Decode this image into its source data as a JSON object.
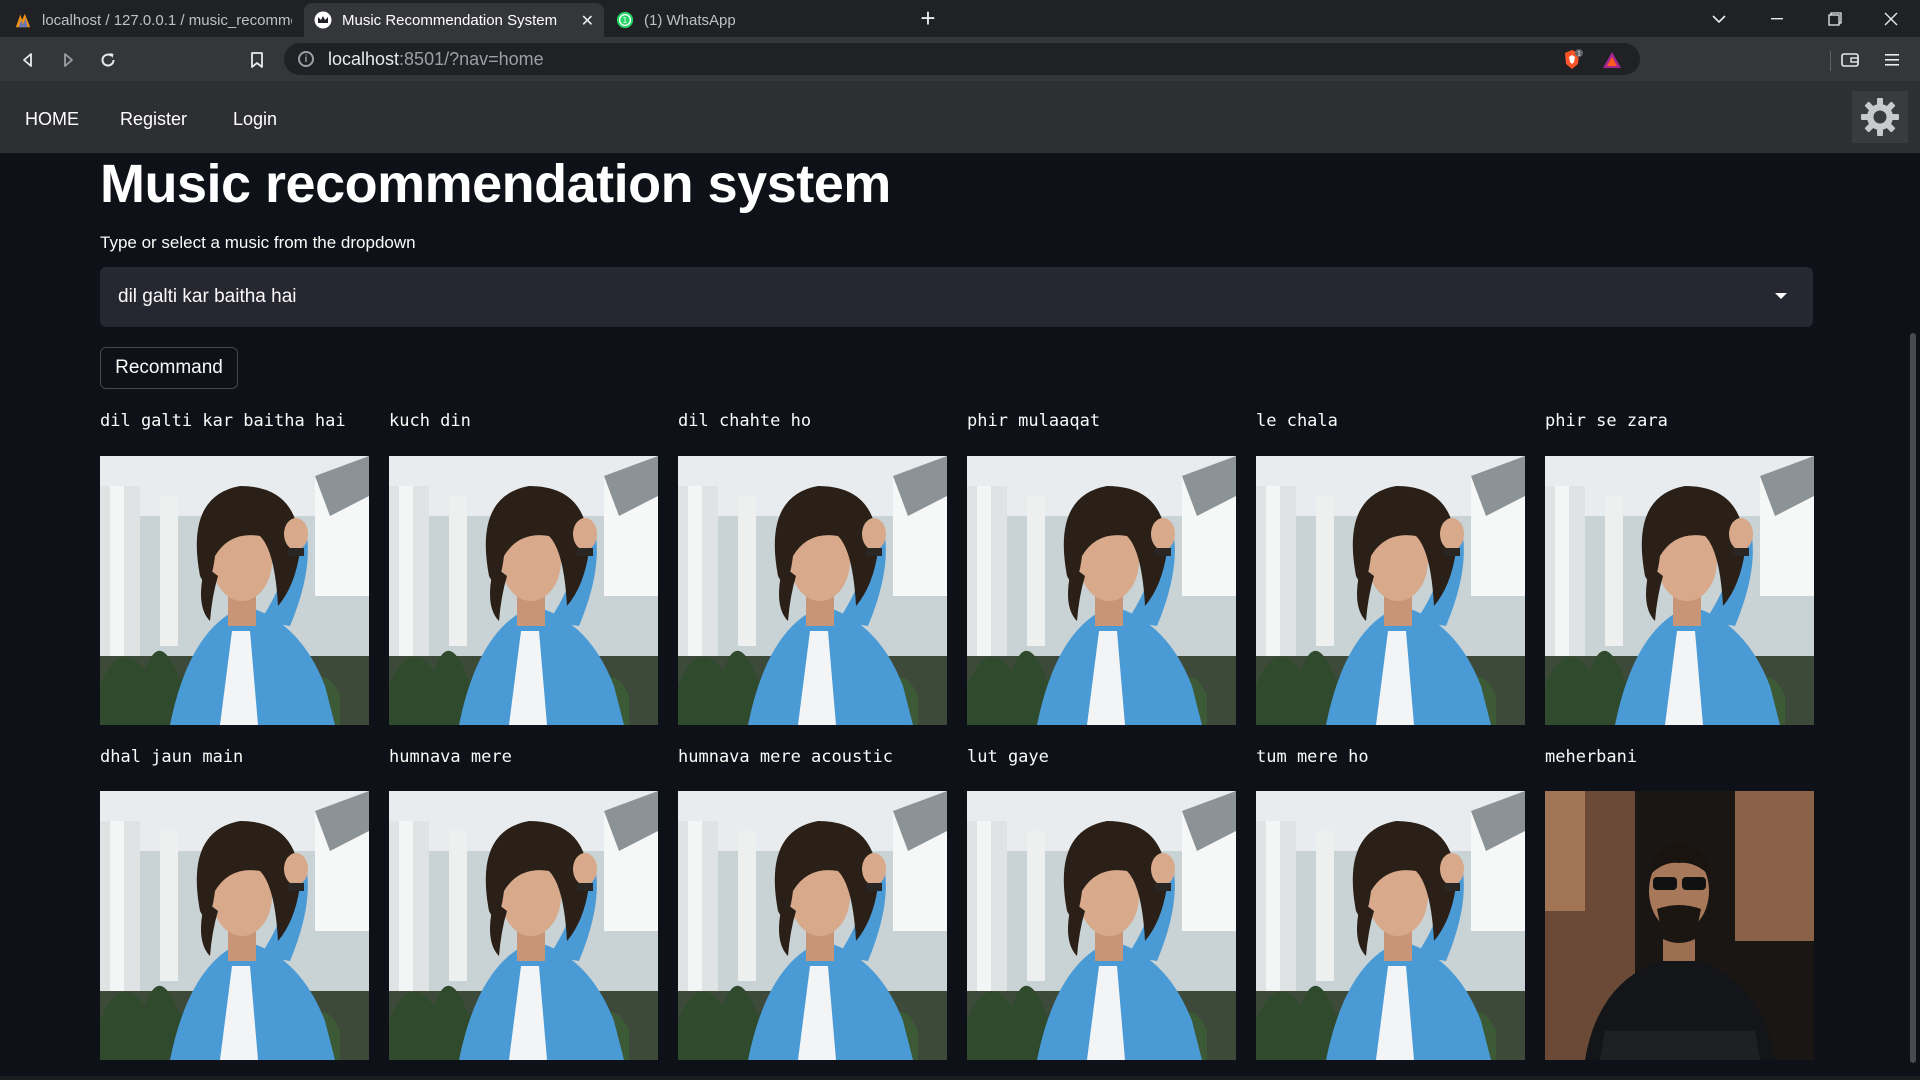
{
  "browser": {
    "tabs": [
      {
        "label": "localhost / 127.0.0.1 / music_recomme",
        "icon": "phpmyadmin-icon",
        "active": false
      },
      {
        "label": "Music Recommendation System",
        "icon": "streamlit-crown-icon",
        "active": true
      },
      {
        "label": "(1) WhatsApp",
        "icon": "whatsapp-icon",
        "active": false
      }
    ],
    "url_host": "localhost",
    "url_rest": ":8501/?nav=home"
  },
  "nav": {
    "home": "HOME",
    "register": "Register",
    "login": "Login"
  },
  "page": {
    "title": "Music recommendation system",
    "select_label": "Type or select a music from the dropdown",
    "selected_song": "dil galti kar baitha hai",
    "recommend_button": "Recommand"
  },
  "results": [
    {
      "title": "dil galti kar baitha hai",
      "artist_image": "curly-hair-blue-shirt"
    },
    {
      "title": "kuch din",
      "artist_image": "curly-hair-blue-shirt"
    },
    {
      "title": "dil chahte ho",
      "artist_image": "curly-hair-blue-shirt"
    },
    {
      "title": "phir mulaaqat",
      "artist_image": "curly-hair-blue-shirt"
    },
    {
      "title": "le chala",
      "artist_image": "curly-hair-blue-shirt"
    },
    {
      "title": "phir se zara",
      "artist_image": "curly-hair-blue-shirt"
    },
    {
      "title": "dhal jaun main",
      "artist_image": "curly-hair-blue-shirt"
    },
    {
      "title": "humnava mere",
      "artist_image": "curly-hair-blue-shirt"
    },
    {
      "title": "humnava mere acoustic",
      "artist_image": "curly-hair-blue-shirt"
    },
    {
      "title": "lut gaye",
      "artist_image": "curly-hair-blue-shirt"
    },
    {
      "title": "tum mere ho",
      "artist_image": "curly-hair-blue-shirt"
    },
    {
      "title": "meherbani",
      "artist_image": "sunglasses-black-shirt"
    }
  ],
  "colors": {
    "background": "#0e1117",
    "nav_bar": "#2e2f32",
    "select_bg": "#262730",
    "shirt_blue": "#4a9ad6"
  }
}
